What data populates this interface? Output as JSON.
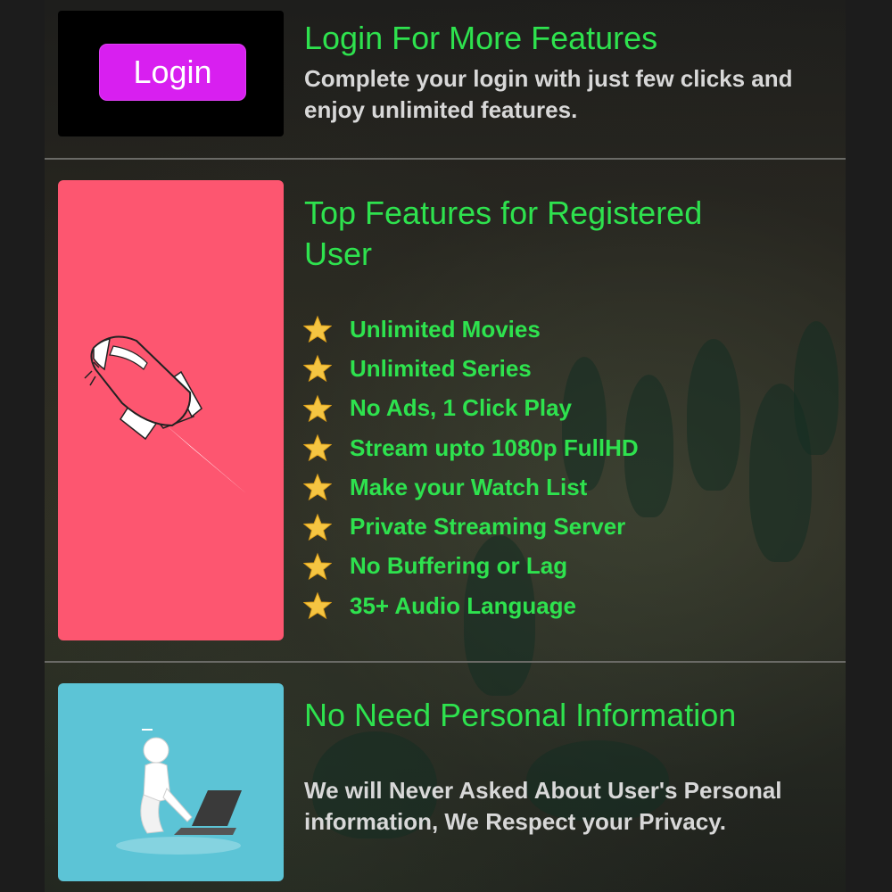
{
  "login_card": {
    "button_label": "Login",
    "title": "Login For More Features",
    "description": "Complete your login with just few clicks and enjoy unlimited features."
  },
  "features_card": {
    "title": "Top Features for Registered User",
    "illustration": "rocket-illustration",
    "items": [
      {
        "icon": "star-icon",
        "label": "Unlimited Movies"
      },
      {
        "icon": "star-icon",
        "label": "Unlimited Series"
      },
      {
        "icon": "star-icon",
        "label": "No Ads, 1 Click Play"
      },
      {
        "icon": "star-icon",
        "label": "Stream upto 1080p FullHD"
      },
      {
        "icon": "star-icon",
        "label": "Make your Watch List"
      },
      {
        "icon": "star-icon",
        "label": "Private Streaming Server"
      },
      {
        "icon": "star-icon",
        "label": "No Buffering or Lag"
      },
      {
        "icon": "star-icon",
        "label": "35+ Audio Language"
      }
    ]
  },
  "privacy_card": {
    "title": "No Need Personal Information",
    "illustration": "user-laptop-illustration",
    "description": "We will Never Asked About User's Personal information, We Respect your Privacy."
  },
  "colors": {
    "accent_green": "#2ee24e",
    "login_button": "#d81ff0",
    "rocket_tile": "#fd5670",
    "privacy_tile": "#5cc4d6",
    "description_text": "#d8d8d8"
  }
}
